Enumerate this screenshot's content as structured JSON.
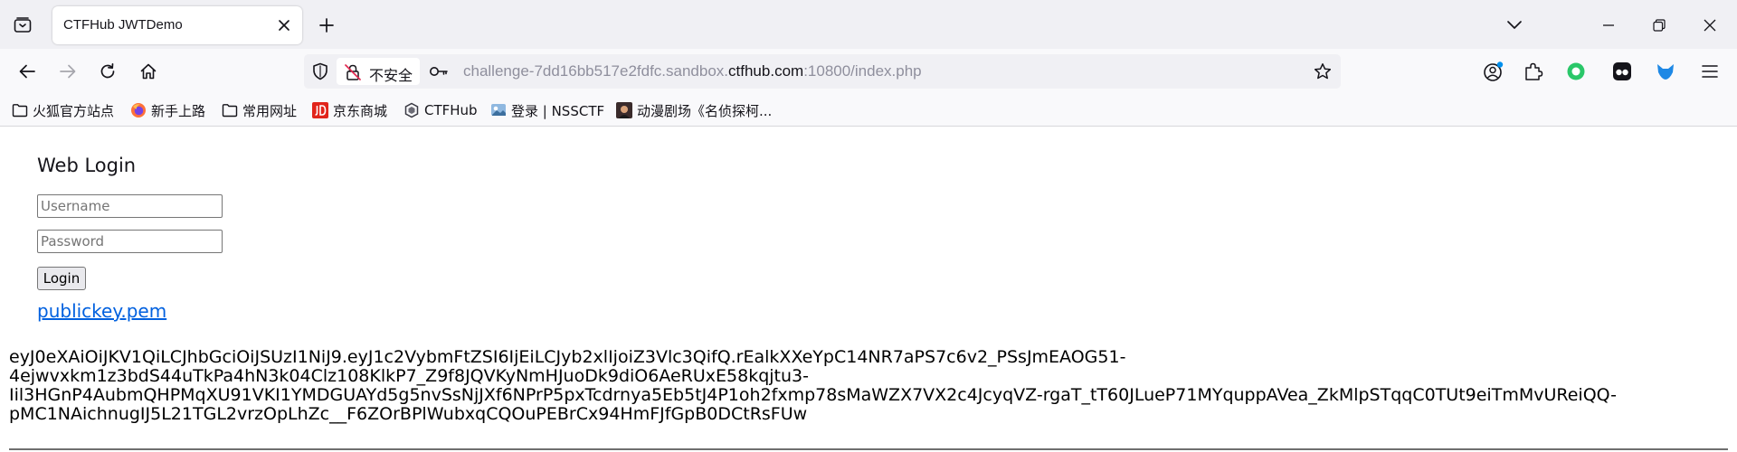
{
  "browser": {
    "tab_title": "CTFHub JWTDemo",
    "url_security_label": "不安全",
    "url_prefix": "challenge-7dd16bb517e2fdfc.sandbox.",
    "url_domain": "ctfhub.com",
    "url_suffix": ":10800/index.php"
  },
  "bookmarks": [
    {
      "label": "火狐官方站点",
      "icon": "folder-icon"
    },
    {
      "label": "新手上路",
      "icon": "firefox-icon"
    },
    {
      "label": "常用网址",
      "icon": "folder-icon"
    },
    {
      "label": "京东商城",
      "icon": "jd-icon"
    },
    {
      "label": "CTFHub",
      "icon": "ctfhub-icon"
    },
    {
      "label": "登录 | NSSCTF",
      "icon": "nssctf-icon"
    },
    {
      "label": "动漫剧场《名侦探柯...",
      "icon": "anime-icon"
    }
  ],
  "page": {
    "heading": "Web Login",
    "username_placeholder": "Username",
    "password_placeholder": "Password",
    "login_label": "Login",
    "pem_link": "publickey.pem",
    "token_lines": [
      "eyJ0eXAiOiJKV1QiLCJhbGciOiJSUzI1NiJ9.eyJ1c2VybmFtZSI6IjEiLCJyb2xlIjoiZ3Vlc3QifQ.rEalkXXeYpC14NR7aPS7c6v2_PSsJmEAOG51-",
      "4ejwvxkm1z3bdS44uTkPa4hN3k04Clz108KlkP7_Z9f8JQVKyNmHJuoDk9diO6AeRUxE58kqjtu3-",
      "Iil3HGnP4AubmQHPMqXU91VKI1YMDGUAYd5g5nvSsNjJXf6NPrP5pxTcdrnya5Eb5tJ4P1oh2fxmp78sMaWZX7VX2c4JcyqVZ-rgaT_tT60JLueP71MYquppAVea_ZkMlpSTqqC0TUt9eiTmMvUReiQQ-",
      "pMC1NAichnugIJ5L21TGL2vrzOpLhZc__F6ZOrBPlWubxqCQOuPEBrCx94HmFJfGpB0DCtRsFUw"
    ]
  },
  "colors": {
    "link": "#0060df",
    "tabstrip_bg": "#f0f0f4",
    "toolbar_bg": "#f9f9fb",
    "green_extension": "#2ac769",
    "blue_extension": "#1e88e5"
  }
}
